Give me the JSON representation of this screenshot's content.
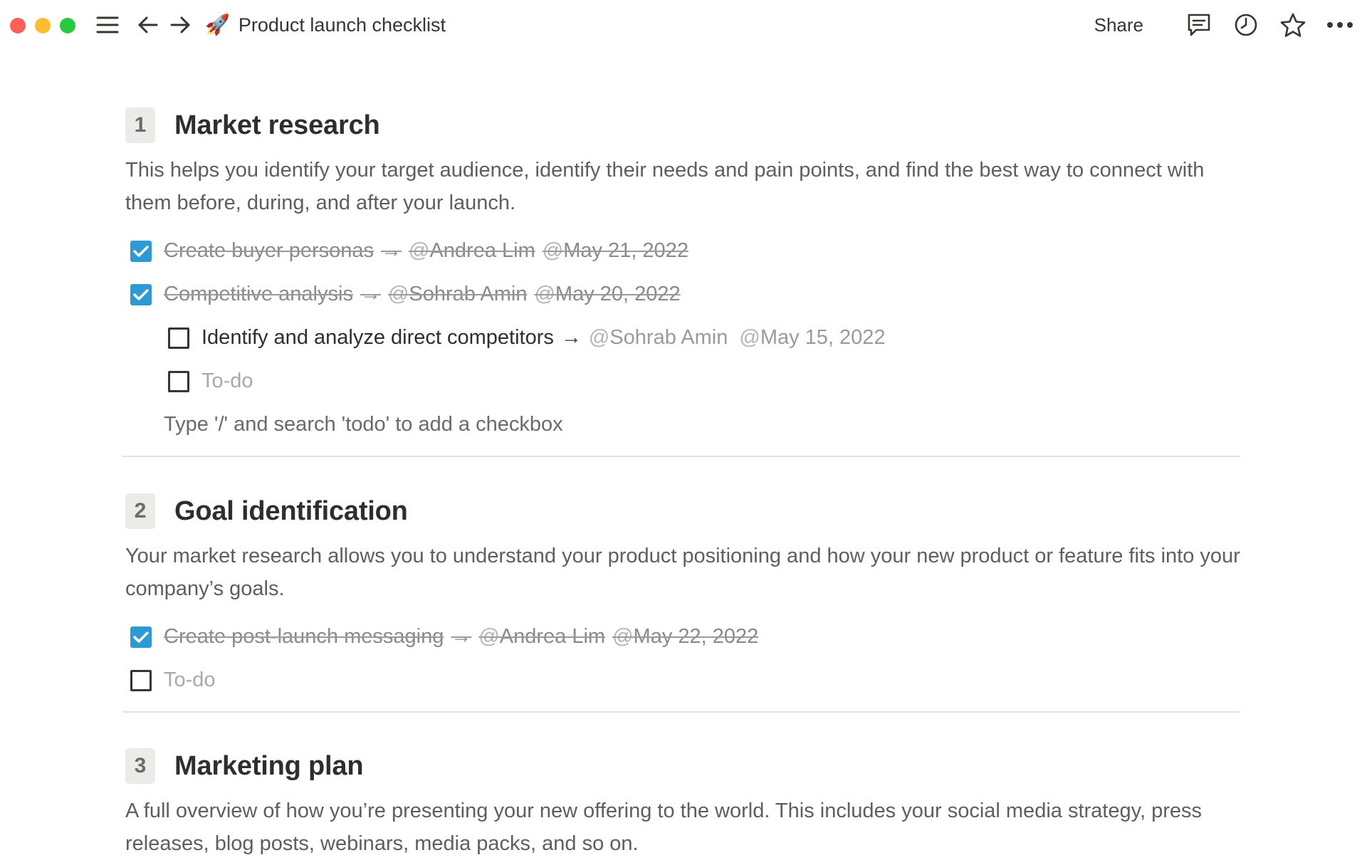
{
  "window": {
    "title": "Product launch checklist",
    "emoji": "🚀"
  },
  "topbar": {
    "share_label": "Share",
    "icons": [
      "menu-icon",
      "back-arrow-icon",
      "forward-arrow-icon",
      "comment-icon",
      "history-clock-icon",
      "star-icon",
      "more-dots-icon"
    ]
  },
  "sections": [
    {
      "number": "1",
      "title": "Market research",
      "description": "This helps you identify your target audience, identify their needs and pain points, and find the best way to connect with them before, during, and after your launch.",
      "todos": [
        {
          "task": "Create buyer personas",
          "arrow": "→",
          "person": "Andrea Lim",
          "date": "May 21, 2022",
          "checked": true
        },
        {
          "task": "Competitive analysis",
          "arrow": "→",
          "person": "Sohrab Amin",
          "date": "May 20, 2022",
          "checked": true
        }
      ],
      "subtodos": [
        {
          "task": "Identify and analyze direct competitors",
          "arrow": "→",
          "person": "Sohrab Amin",
          "date": "May 15, 2022",
          "checked": false
        },
        {
          "task": "To-do",
          "checked": false
        }
      ],
      "hint": "Type '/' and search 'todo' to add a checkbox"
    },
    {
      "number": "2",
      "title": "Goal identification",
      "description": "Your market research allows you to understand your product positioning and how your new product or feature fits into your company’s goals.",
      "todos": [
        {
          "task": "Create post-launch messaging",
          "arrow": "→",
          "person": "Andrea Lim",
          "date": "May 22, 2022",
          "checked": true
        },
        {
          "task": "To-do",
          "checked": false
        }
      ]
    },
    {
      "number": "3",
      "title": "Marketing plan",
      "description": "A full overview of how you’re presenting your new offering to the world. This includes your social media strategy, press releases, blog posts, webinars, media packs, and so on."
    }
  ],
  "colors": {
    "checkbox_checked": "#2e9ad4",
    "traffic_red": "#ff5f57",
    "traffic_yellow": "#febc2e",
    "traffic_green": "#28c840"
  }
}
